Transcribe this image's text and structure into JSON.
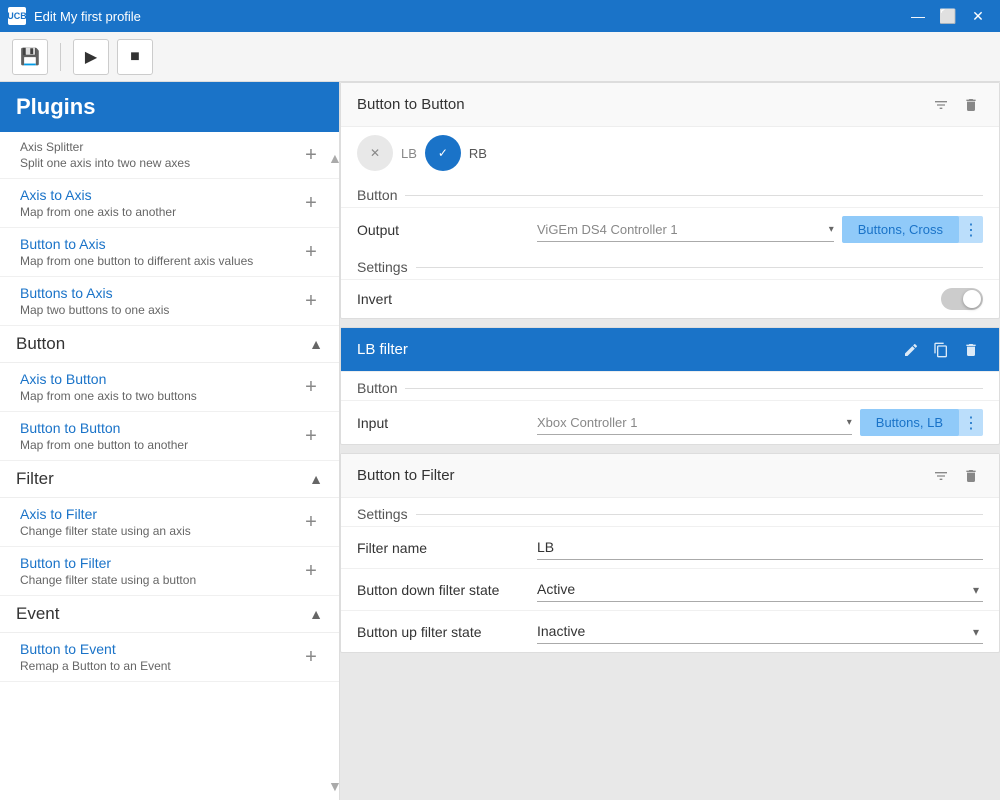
{
  "window": {
    "title": "Edit My first profile",
    "icon_label": "UCB"
  },
  "toolbar": {
    "save_label": "💾",
    "play_label": "▶",
    "stop_label": "■"
  },
  "sidebar": {
    "header": "Plugins",
    "sections": [
      {
        "id": "axis",
        "items": [
          {
            "name": "Axis to Axis",
            "desc": "Map from one axis to another"
          },
          {
            "name": "Button to Axis",
            "desc": "Map from one button to different axis values"
          },
          {
            "name": "Buttons to Axis",
            "desc": "Map two buttons to one axis"
          }
        ]
      },
      {
        "id": "button",
        "title": "Button",
        "items": [
          {
            "name": "Axis to Button",
            "desc": "Map from one axis to two buttons"
          },
          {
            "name": "Button to Button",
            "desc": "Map from one button to another"
          }
        ]
      },
      {
        "id": "filter",
        "title": "Filter",
        "items": [
          {
            "name": "Axis to Filter",
            "desc": "Change filter state using an axis"
          },
          {
            "name": "Button to Filter",
            "desc": "Change filter state using a button"
          }
        ]
      },
      {
        "id": "event",
        "title": "Event",
        "items": [
          {
            "name": "Button to Event",
            "desc": "Remap a Button to an Event"
          }
        ]
      }
    ]
  },
  "cards": {
    "button_to_button": {
      "title": "Button to Button",
      "buttons": [
        {
          "id": "x",
          "label": "✕",
          "state": "inactive"
        },
        {
          "id": "lb",
          "label": "LB",
          "state": "inactive"
        },
        {
          "id": "rb_check",
          "label": "✓",
          "state": "active"
        },
        {
          "id": "rb",
          "label": "RB",
          "state": "inactive"
        }
      ],
      "button_section": "Button",
      "output_label": "Output",
      "output_device": "ViGEm DS4 Controller 1",
      "output_value": "Buttons, Cross",
      "settings_section": "Settings",
      "invert_label": "Invert",
      "invert_state": false
    },
    "lb_filter": {
      "title": "LB filter",
      "button_section": "Button",
      "input_label": "Input",
      "input_device": "Xbox Controller 1",
      "input_value": "Buttons, LB"
    },
    "button_to_filter": {
      "title": "Button to Filter",
      "settings_section": "Settings",
      "filter_name_label": "Filter name",
      "filter_name_value": "LB",
      "button_down_label": "Button down filter state",
      "button_down_value": "Active",
      "button_down_options": [
        "Active",
        "Inactive"
      ],
      "button_up_label": "Button up filter state",
      "button_up_value": "Inactive",
      "button_up_options": [
        "Active",
        "Inactive"
      ]
    }
  }
}
